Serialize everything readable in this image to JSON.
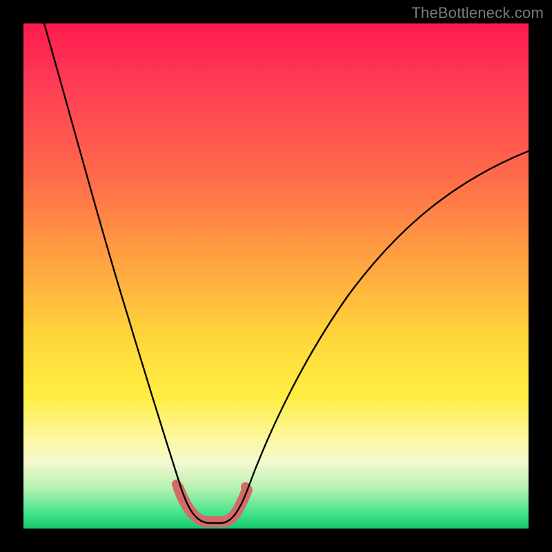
{
  "watermark": "TheBottleneck.com",
  "colors": {
    "background": "#000000",
    "gradient_top": "#ff1a4f",
    "gradient_mid": "#ffd63a",
    "gradient_bottom": "#18c871",
    "curve": "#000000",
    "highlight": "#d46a6a"
  },
  "chart_data": {
    "type": "line",
    "title": "",
    "xlabel": "",
    "ylabel": "",
    "xlim": [
      0,
      100
    ],
    "ylim": [
      0,
      100
    ],
    "x": [
      4,
      6,
      8,
      10,
      12,
      14,
      16,
      18,
      20,
      22,
      24,
      26,
      28,
      30,
      31,
      32,
      33,
      34,
      35,
      36,
      37,
      38,
      39,
      40,
      42,
      45,
      50,
      55,
      60,
      65,
      70,
      75,
      80,
      85,
      90,
      95,
      100
    ],
    "values": [
      100,
      94,
      88,
      82,
      75,
      68,
      61,
      54,
      47,
      40,
      33,
      26,
      19,
      10,
      6,
      3,
      1,
      0,
      0,
      0,
      0,
      0,
      1,
      3,
      7,
      12,
      20,
      27,
      33,
      39,
      44,
      49,
      53,
      57,
      61,
      64,
      67
    ],
    "highlight_range_x": [
      30,
      40
    ],
    "annotations": []
  }
}
